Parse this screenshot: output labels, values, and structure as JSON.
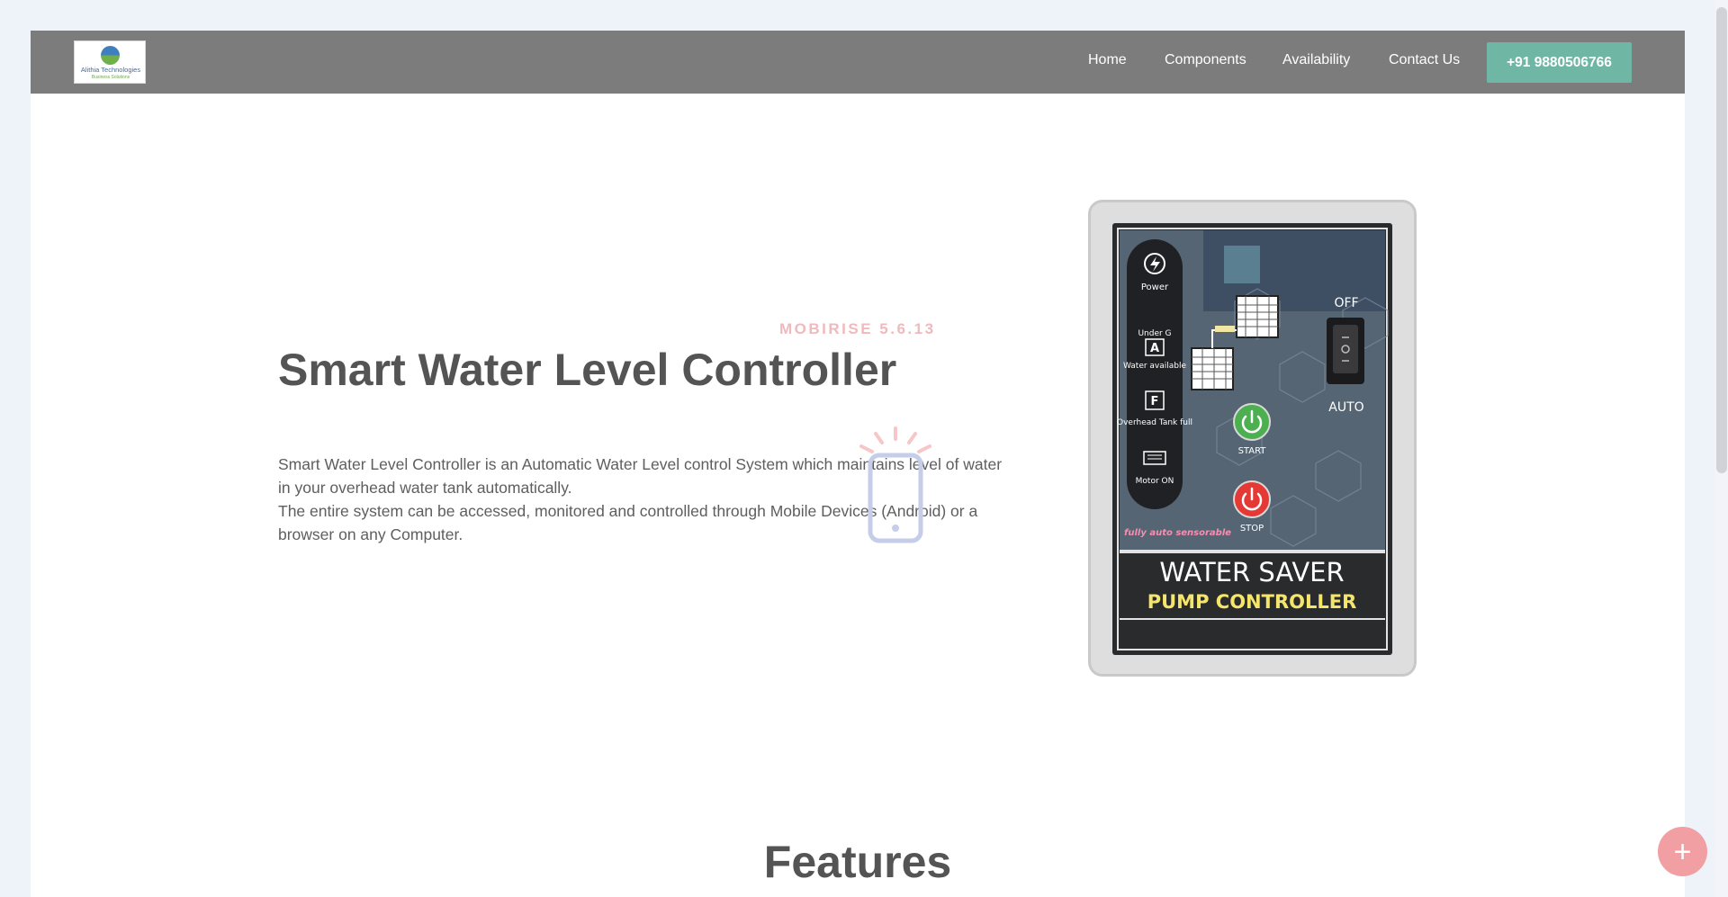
{
  "nav": {
    "logo": {
      "name": "Alithia Technologies",
      "tagline": "Business Solutions"
    },
    "links": [
      "Home",
      "Components",
      "Availability",
      "Contact Us"
    ],
    "phone": "+91 9880506766"
  },
  "watermark": "MOBIRISE 5.6.13",
  "hero": {
    "title": "Smart Water Level Controller",
    "paragraph1": "Smart Water Level Controller is an Automatic Water Level control System which maintains level of water in your overhead water tank automatically.",
    "paragraph2": "The entire system can be accessed, monitored and controlled through Mobile Devices (Android) or a browser on any Computer."
  },
  "device": {
    "indicators": [
      "Power",
      "Under G",
      "A",
      "Water available",
      "F",
      "Overhead Tank full",
      "Motor ON"
    ],
    "switch_off": "OFF",
    "switch_auto": "AUTO",
    "start": "START",
    "stop": "STOP",
    "tagline": "fully auto sensorable",
    "brand_line1": "WATER SAVER",
    "brand_line2": "PUMP CONTROLLER"
  },
  "features": {
    "title": "Features"
  },
  "colors": {
    "navbar": "#7c7c7c",
    "phone_button": "#6fb6a4",
    "fab": "#f19fa3",
    "watermark": "#f0b9bd"
  },
  "icons": [
    "bolt-icon",
    "phone-glow-icon",
    "power-icon",
    "plus-icon"
  ]
}
